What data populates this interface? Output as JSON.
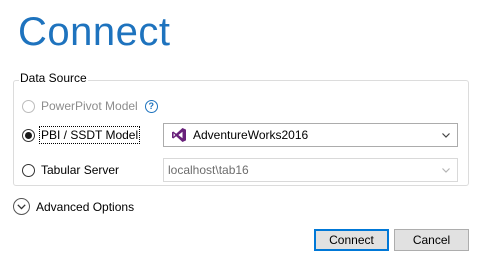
{
  "dialog": {
    "title": "Connect"
  },
  "data_source": {
    "label": "Data Source",
    "options": [
      {
        "label": "PowerPivot Model",
        "selected": false,
        "enabled": false,
        "help_icon": "question-circle-icon"
      },
      {
        "label": "PBI / SSDT Model",
        "selected": true,
        "enabled": true
      },
      {
        "label": "Tabular Server",
        "selected": false,
        "enabled": true
      }
    ],
    "pbi_model_select": {
      "value": "AdventureWorks2016",
      "icon": "visual-studio-icon"
    },
    "server_select": {
      "value": "localhost\\tab16",
      "enabled": false
    }
  },
  "advanced": {
    "label": "Advanced Options",
    "expanded": false
  },
  "buttons": {
    "connect": "Connect",
    "cancel": "Cancel"
  },
  "colors": {
    "title": "#1e73be",
    "vs_icon": "#68217a",
    "default_button_border": "#0078d7"
  }
}
